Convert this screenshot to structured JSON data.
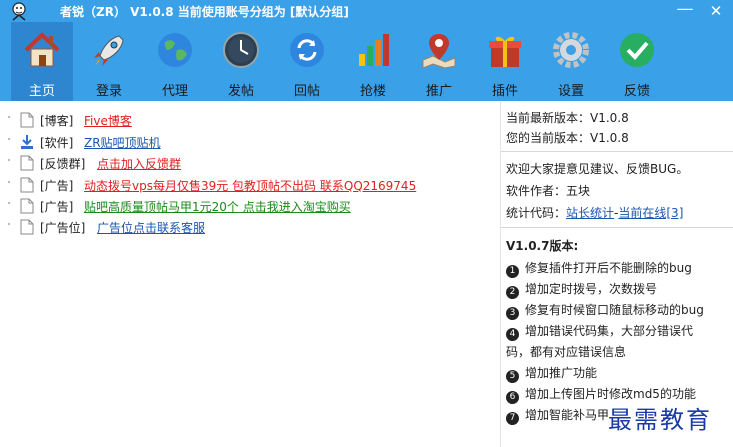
{
  "window": {
    "title": "者锐（ZR）  V1.0.8  当前使用账号分组为  [默认分组]",
    "minimize_label": "—",
    "close_label": "✕"
  },
  "toolbar": [
    {
      "label": "主页",
      "icon": "house-icon",
      "active": true
    },
    {
      "label": "登录",
      "icon": "rocket-icon"
    },
    {
      "label": "代理",
      "icon": "globe-icon"
    },
    {
      "label": "发帖",
      "icon": "clock-icon"
    },
    {
      "label": "回帖",
      "icon": "refresh-icon"
    },
    {
      "label": "抢楼",
      "icon": "bar-chart-icon"
    },
    {
      "label": "推广",
      "icon": "map-pin-icon"
    },
    {
      "label": "插件",
      "icon": "gift-icon"
    },
    {
      "label": "设置",
      "icon": "gear-icon"
    },
    {
      "label": "反馈",
      "icon": "check-icon"
    }
  ],
  "links": [
    {
      "category": "[博客]",
      "text": "Five博客",
      "color": "#e02020",
      "icon": "document-icon"
    },
    {
      "category": "[软件]",
      "text": "ZR贴吧顶贴机",
      "color": "#1a55b0",
      "icon": "download-icon"
    },
    {
      "category": "[反馈群]",
      "text": "点击加入反馈群",
      "color": "#e02020",
      "icon": "document-icon"
    },
    {
      "category": "[广告]",
      "text": "动态拨号vps每月仅售39元 包教顶帖不出码 联系QQ2169745",
      "color": "#e02020",
      "icon": "document-icon"
    },
    {
      "category": "[广告]",
      "text": "贴吧高质量顶帖马甲1元20个 点击我进入淘宝购买",
      "color": "#1a8a1a",
      "icon": "document-icon"
    },
    {
      "category": "[广告位]",
      "text": "广告位点击联系客服",
      "color": "#1a55b0",
      "icon": "document-icon"
    }
  ],
  "info": {
    "latest_version": "当前最新版本：V1.0.8",
    "current_version": "您的当前版本：V1.0.8",
    "welcome": "欢迎大家提意见建议、反馈BUG。",
    "author": "软件作者：五块",
    "stats_prefix": "统计代码：",
    "stats_link1": "站长统计",
    "stats_dash": "-",
    "stats_link2": "当前在线[3]"
  },
  "changelog": {
    "title": "V1.0.7版本:",
    "items": [
      {
        "n": "1",
        "text": "修复插件打开后不能删除的bug"
      },
      {
        "n": "2",
        "text": "增加定时拨号，次数拨号"
      },
      {
        "n": "3",
        "text": "修复有时候窗口随鼠标移动的bug"
      },
      {
        "n": "4",
        "text": "增加错误代码集，大部分错误代"
      },
      {
        "n": "",
        "text": "码，都有对应错误信息"
      },
      {
        "n": "5",
        "text": "增加推广功能"
      },
      {
        "n": "6",
        "text": "增加上传图片时修改md5的功能"
      },
      {
        "n": "7",
        "text": "增加智能补马甲"
      }
    ]
  },
  "watermark": "最需教育"
}
